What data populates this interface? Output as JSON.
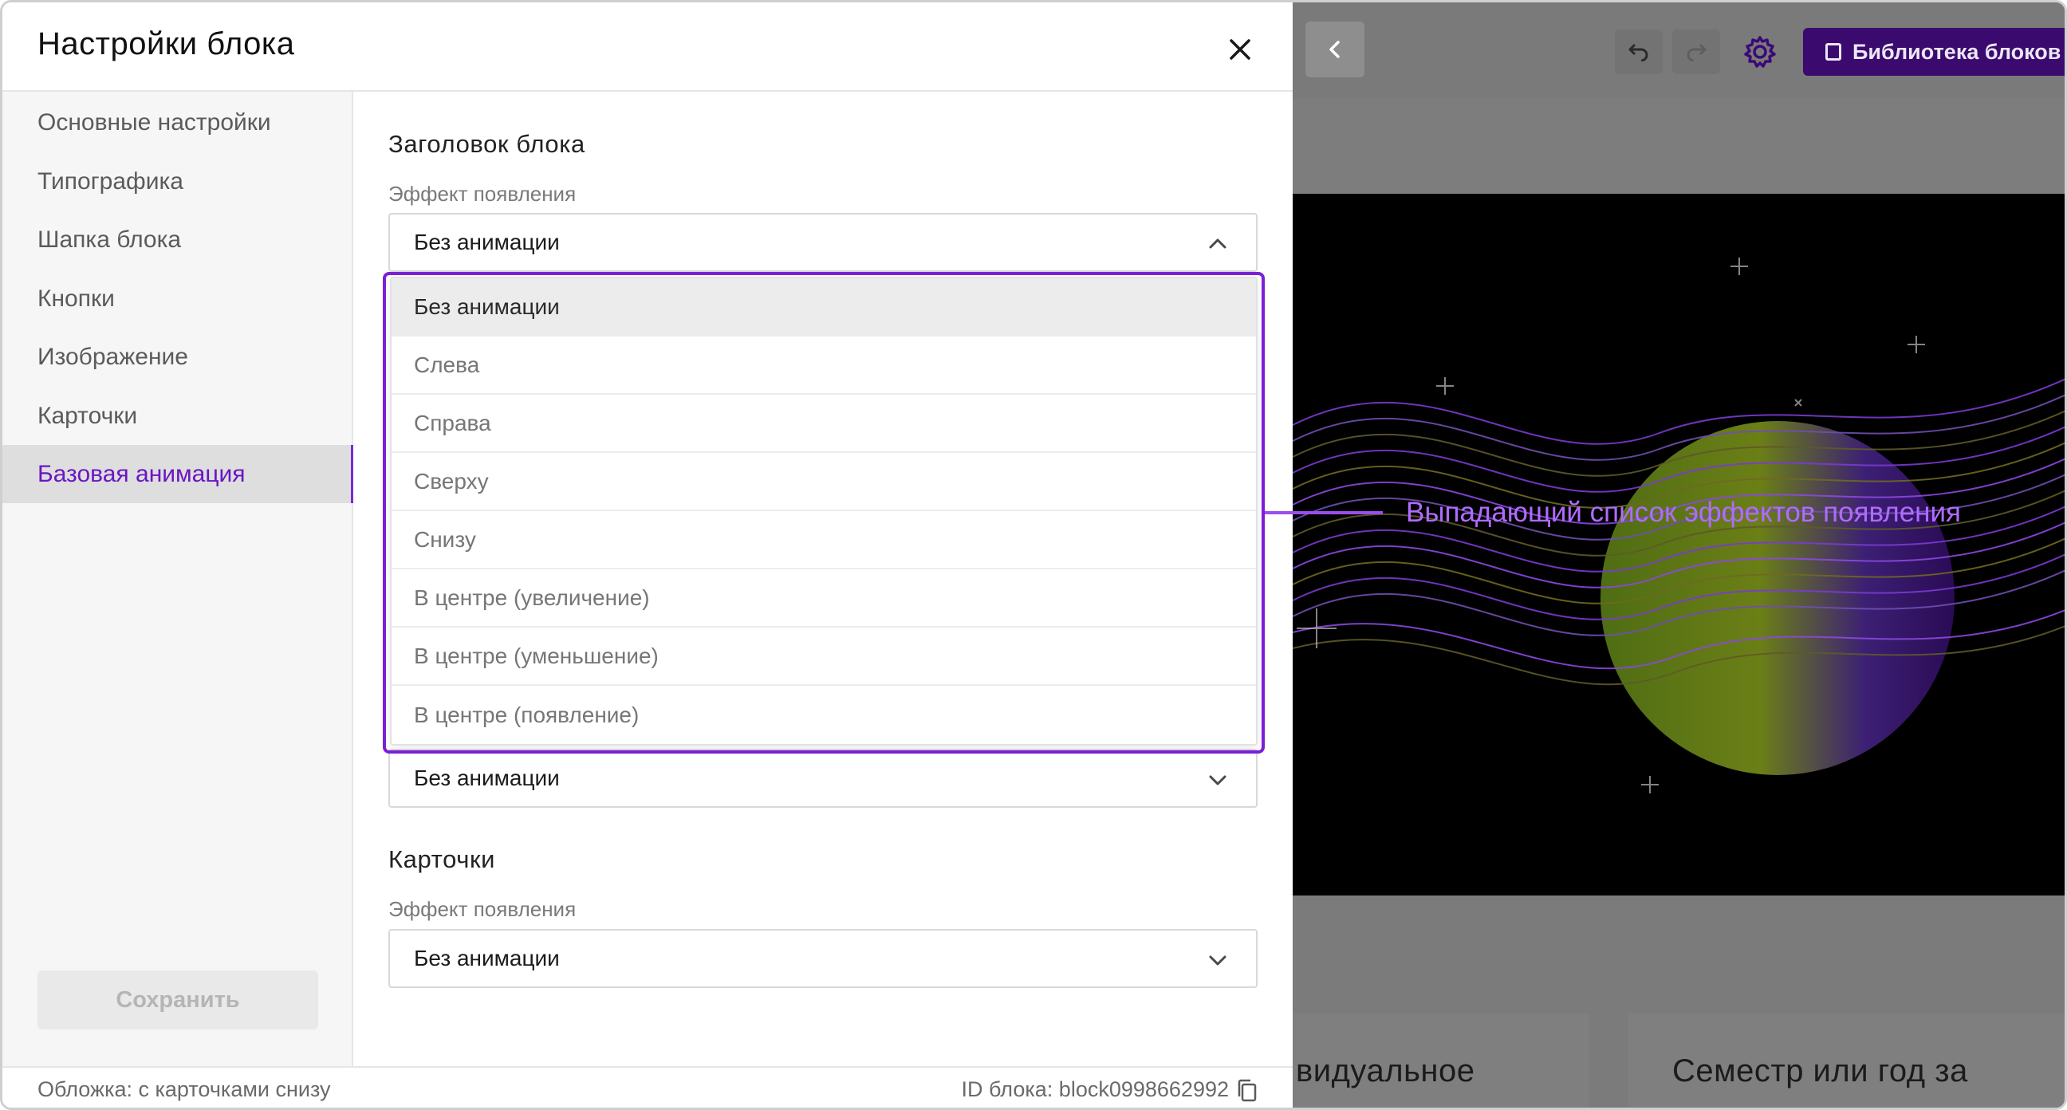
{
  "modal": {
    "title": "Настройки блока",
    "sidebar": {
      "items": [
        {
          "label": "Основные настройки"
        },
        {
          "label": "Типографика"
        },
        {
          "label": "Шапка блока"
        },
        {
          "label": "Кнопки"
        },
        {
          "label": "Изображение"
        },
        {
          "label": "Карточки"
        },
        {
          "label": "Базовая анимация",
          "active": true
        }
      ],
      "save_label": "Сохранить"
    },
    "sections": [
      {
        "title": "Заголовок блока",
        "field_label": "Эффект появления",
        "value": "Без анимации",
        "open": true
      },
      {
        "value": "Без анимации"
      },
      {
        "title": "Карточки",
        "field_label": "Эффект появления",
        "value": "Без анимации"
      }
    ],
    "dropdown": {
      "options": [
        "Без анимации",
        "Слева",
        "Справа",
        "Сверху",
        "Снизу",
        "В центре (увеличение)",
        "В центре (уменьшение)",
        "В центре (появление)"
      ],
      "selected": "Без анимации"
    },
    "footer": {
      "block_type": "Обложка: с карточками снизу",
      "block_id": "ID блока: block0998662992"
    }
  },
  "annotation": {
    "text": "Выпадающий список эффектов появления",
    "color": "#b06bff"
  },
  "editor": {
    "library_button": "Библиотека блоков",
    "card_texts": [
      "видуальное",
      "Семестр или год за"
    ]
  },
  "colors": {
    "accent": "#7a1fd6",
    "active_text": "#6a16c2",
    "library_bg": "#3a0a6e"
  }
}
